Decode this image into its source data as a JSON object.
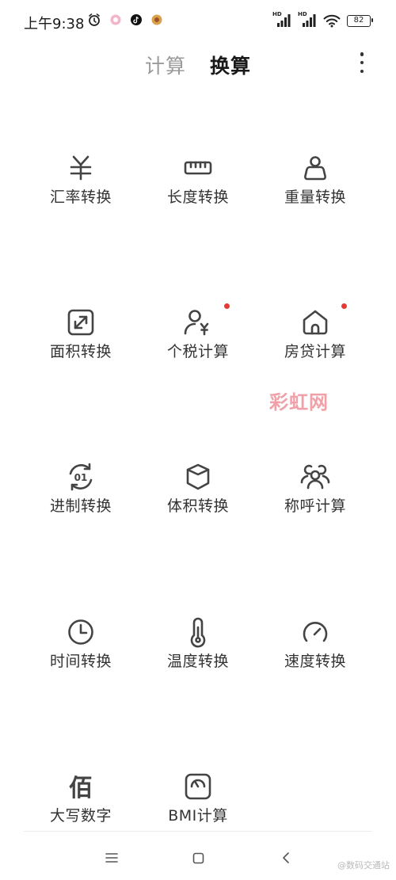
{
  "status": {
    "time": "上午9:38",
    "hd1": "HD",
    "hd2": "HD",
    "battery": "82",
    "icons": [
      "alarm-icon",
      "app-notify-icon",
      "tiktok-icon",
      "app-notify-icon-2",
      "signal-icon",
      "wifi-icon",
      "battery-icon"
    ]
  },
  "header": {
    "tabs": [
      {
        "label": "计算"
      },
      {
        "label": "换算"
      }
    ],
    "menu_icon": "more-vertical-icon"
  },
  "items": [
    {
      "label": "汇率转换",
      "icon": "currency-yuan-icon"
    },
    {
      "label": "长度转换",
      "icon": "ruler-icon"
    },
    {
      "label": "重量转换",
      "icon": "weight-icon"
    },
    {
      "label": "面积转换",
      "icon": "area-icon"
    },
    {
      "label": "个税计算",
      "icon": "tax-person-icon",
      "badge": true
    },
    {
      "label": "房贷计算",
      "icon": "house-icon",
      "badge": true
    },
    {
      "label": "进制转换",
      "icon": "binary-icon"
    },
    {
      "label": "体积转换",
      "icon": "cube-icon"
    },
    {
      "label": "称呼计算",
      "icon": "relatives-icon"
    },
    {
      "label": "时间转换",
      "icon": "clock-icon"
    },
    {
      "label": "温度转换",
      "icon": "thermometer-icon"
    },
    {
      "label": "速度转换",
      "icon": "speedometer-icon"
    },
    {
      "label": "大写数字",
      "icon": "chinese-numeral-icon",
      "glyph": "佰"
    },
    {
      "label": "BMI计算",
      "icon": "scale-icon"
    }
  ],
  "watermark": "彩虹网",
  "footer_mark": "@数码交通站",
  "nav": {
    "icons": [
      "menu-lines-icon",
      "home-square-icon",
      "back-chevron-icon"
    ]
  },
  "colors": {
    "accent": "#1a1a1a",
    "inactive_tab": "#9a9a9a",
    "badge": "#e53935",
    "icon_stroke": "#444444"
  }
}
